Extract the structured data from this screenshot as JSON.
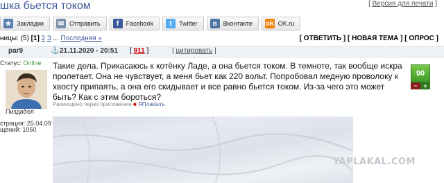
{
  "page": {
    "title": "шка бьется током",
    "print_link": "Версия для печати"
  },
  "share": {
    "buttons": [
      {
        "label": "Закладки",
        "icon": "bookmarks-icon",
        "color": "#5a7fb0"
      },
      {
        "label": "Отправить",
        "icon": "send-email-icon",
        "color": "#7a8fa8"
      },
      {
        "label": "Facebook",
        "icon": "facebook-icon",
        "color": "#3b5998"
      },
      {
        "label": "Twitter",
        "icon": "twitter-icon",
        "color": "#55acee"
      },
      {
        "label": "Вконтакте",
        "icon": "vkontakte-icon",
        "color": "#4c75a3"
      },
      {
        "label": "OK.ru",
        "icon": "odnoklassniki-icon",
        "color": "#ee8208"
      }
    ]
  },
  "pager": {
    "prefix": "ницы: (5)",
    "current": "[1]",
    "pages": [
      "2",
      "3"
    ],
    "ellipsis": "...",
    "last": "Последняя »"
  },
  "actions": {
    "reply": "ОТВЕТИТЬ",
    "new_topic": "НОВАЯ ТЕМА",
    "poll": "ОПРОС"
  },
  "post": {
    "author": "par9",
    "anchor_icon": "⚓",
    "date": "21.11.2020 - 20:51",
    "number": "911",
    "quote_label": "цитировать",
    "status_label": "Статус:",
    "status_value": "Online",
    "avatar_caption": "Пиздабол",
    "registered": "страция: 25.04.09",
    "messages": "щений: 1050",
    "text": "Такие дела. Прикасаюсь к котёнку Ладе, а она бьется током. В темноте, так вообще искра пролетает. Она не чувствует, а меня бьет как 220 вольт. Попробовал медную проволоку к хвосту припаять, а она его скидывает и все равно бьется током. Из-за чего это может быть? Как с этим бороться?",
    "placed_via": "Размещено через приложение",
    "app_name": "ЯПлакалъ",
    "rating": "90",
    "minus": "−",
    "plus": "+"
  },
  "watermark": "YAPLAKAL.COM",
  "colors": {
    "link": "#3b5998",
    "rating_bg": "#4fae33",
    "online": "#3a9a3a",
    "post_number": "#cc0000"
  }
}
